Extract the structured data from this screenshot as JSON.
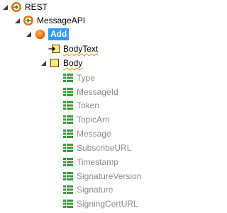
{
  "tree": {
    "root_label": "REST",
    "api_label": "MessageAPI",
    "method_label": "Add",
    "body_text_label": "BodyText",
    "body_label": "Body",
    "fields": [
      "Type",
      "MessageId",
      "Token",
      "TopicArn",
      "Message",
      "SubscribeURL",
      "Timestamp",
      "SignatureVersion",
      "Signature",
      "SigningCertURL"
    ]
  },
  "colors": {
    "selection": "#3399ff",
    "connector_orange": "#f07010",
    "connector_green": "#3a9a3a",
    "struct_yellow": "#ffe680",
    "field_green": "#3d9a3d",
    "spell_squiggle": "#c9a800"
  },
  "icons": {
    "root": "rest-connector-icon",
    "api": "api-connector-icon",
    "method": "method-icon",
    "body_text": "input-param-icon",
    "body": "structure-icon",
    "field": "field-icon"
  }
}
